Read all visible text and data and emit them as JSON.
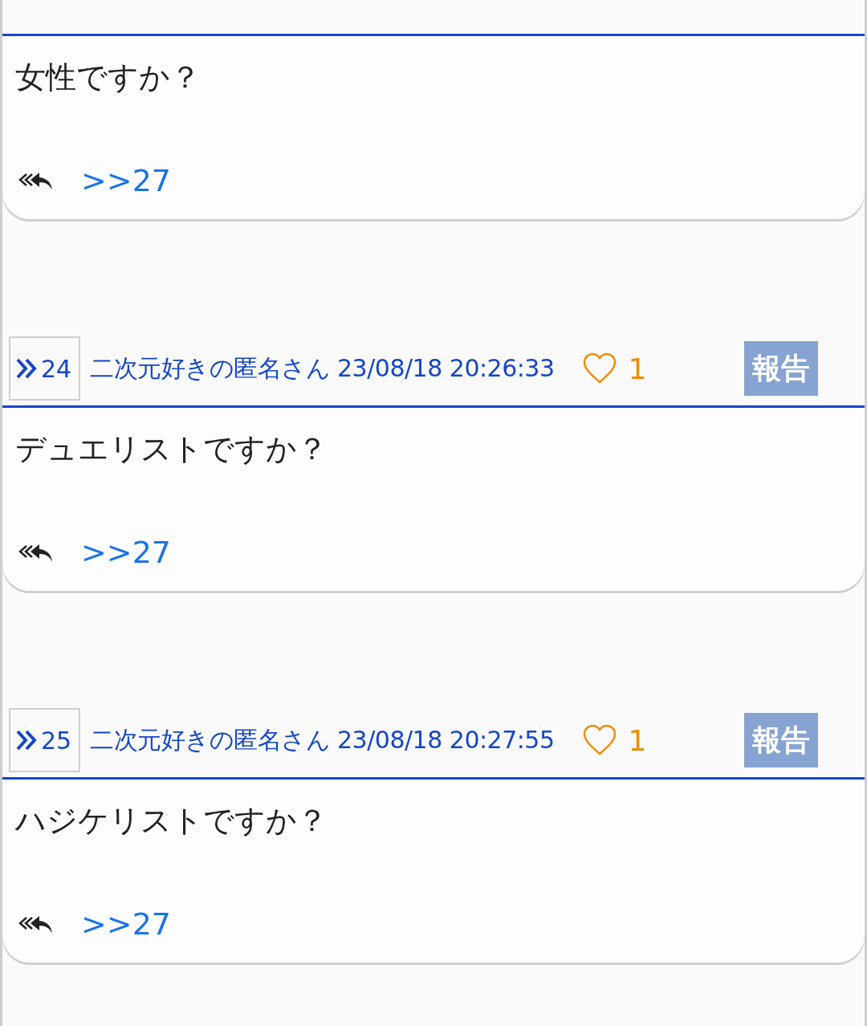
{
  "posts": [
    {
      "body": "女性ですか？",
      "reply_link": ">>27"
    },
    {
      "number": "24",
      "author": "二次元好きの匿名さん",
      "date": "23/08/18 20:26:33",
      "likes": "1",
      "report": "報告",
      "body": "デュエリストですか？",
      "reply_link": ">>27"
    },
    {
      "number": "25",
      "author": "二次元好きの匿名さん",
      "date": "23/08/18 20:27:55",
      "likes": "1",
      "report": "報告",
      "body": "ハジケリストですか？",
      "reply_link": ">>27"
    }
  ]
}
